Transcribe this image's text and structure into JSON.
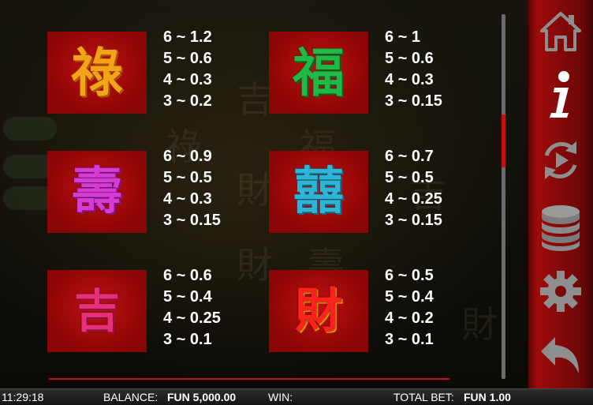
{
  "paytable": [
    {
      "symbol": "祿",
      "color": "#f3a21a",
      "pays": [
        "6 ~ 1.2",
        "5 ~ 0.6",
        "4 ~ 0.3",
        "3 ~ 0.2"
      ]
    },
    {
      "symbol": "福",
      "color": "#22b845",
      "pays": [
        "6 ~ 1",
        "5 ~ 0.6",
        "4 ~ 0.3",
        "3 ~ 0.15"
      ]
    },
    {
      "symbol": "壽",
      "color": "#d43cd4",
      "pays": [
        "6 ~ 0.9",
        "5 ~ 0.5",
        "4 ~ 0.3",
        "3 ~ 0.15"
      ]
    },
    {
      "symbol": "囍",
      "color": "#2fb4d6",
      "pays": [
        "6 ~ 0.7",
        "5 ~ 0.5",
        "4 ~ 0.25",
        "3 ~ 0.15"
      ]
    },
    {
      "symbol": "吉",
      "color": "#e8307a",
      "pays": [
        "6 ~ 0.6",
        "5 ~ 0.4",
        "4 ~ 0.25",
        "3 ~ 0.1"
      ]
    },
    {
      "symbol": "財",
      "color": "#ff2020",
      "pays": [
        "6 ~ 0.5",
        "5 ~ 0.4",
        "4 ~ 0.2",
        "3 ~ 0.1"
      ]
    }
  ],
  "sidebar": {
    "buttons": [
      "home-icon",
      "info-icon",
      "autoplay-icon",
      "coins-icon",
      "gear-icon",
      "back-arrow-icon"
    ],
    "active": "info-icon"
  },
  "status": {
    "time": "11:29:18",
    "balance_label": "BALANCE:",
    "balance_value": "FUN 5,000.00",
    "win_label": "WIN:",
    "win_value": "",
    "total_bet_label": "TOTAL BET:",
    "total_bet_value": "FUN 1.00"
  },
  "colors": {
    "accent": "#c41010",
    "panel_red": "#9e0b0b"
  }
}
